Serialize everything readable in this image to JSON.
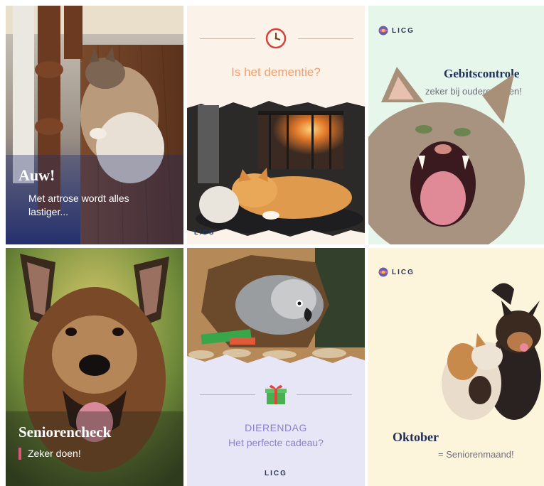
{
  "tiles": {
    "arthritis": {
      "title": "Auw!",
      "subtitle": "Met artrose wordt alles lastiger..."
    },
    "dementia": {
      "question": "Is het dementie?",
      "logo": "LICG"
    },
    "dental": {
      "logo": "LICG",
      "title": "Gebitscontrole",
      "subtitle": "zeker bij oudere dieren!"
    },
    "senior_check": {
      "title": "Seniorencheck",
      "subtitle": "Zeker doen!"
    },
    "animal_day": {
      "title": "DIERENDAG",
      "subtitle": "Het perfecte cadeau?",
      "logo": "LICG"
    },
    "october": {
      "logo": "LICG",
      "title": "Oktober",
      "subtitle": "= Seniorenmaand!"
    }
  },
  "icons": {
    "clock": "clock-icon",
    "gift": "gift-icon",
    "logo_emblem": "globe-emblem-icon"
  },
  "colors": {
    "accent_pink": "#d8577a",
    "navy": "#20305a",
    "orange_text": "#f0a070",
    "lilac_text": "#8a7fd0"
  }
}
